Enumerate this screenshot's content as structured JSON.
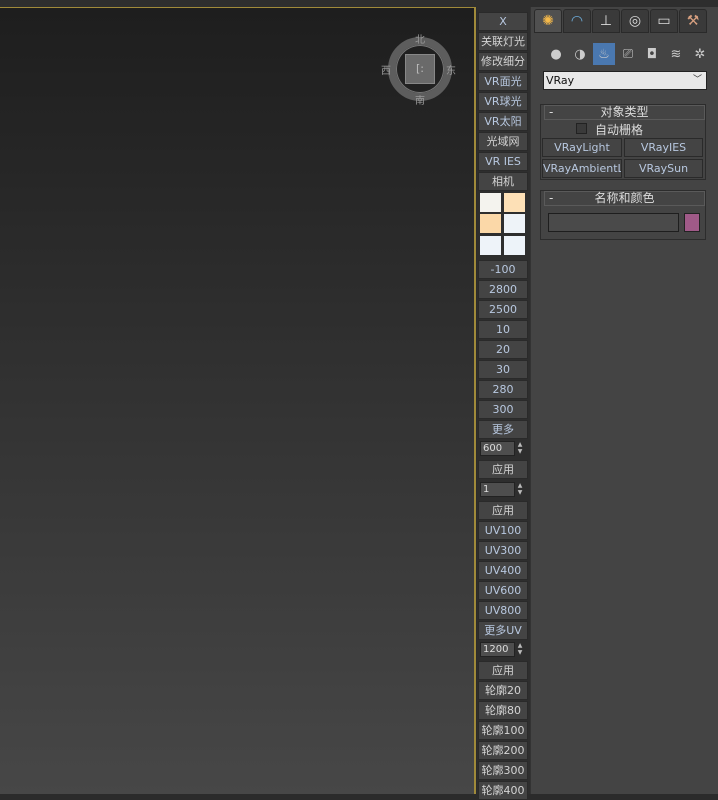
{
  "viewcube": {
    "north": "北",
    "south": "南",
    "east": "东",
    "west": "西",
    "face": "[:"
  },
  "toolbar": {
    "top_buttons": [
      "X",
      "关联灯光",
      "修改细分",
      "VR面光",
      "VR球光",
      "VR太阳",
      "光域网",
      "VR IES",
      "相机"
    ],
    "swatch_colors": [
      "#f4f3ee",
      "#fde0b6",
      "#fbd8a8",
      "#eef3f8",
      "#eef3f9",
      "#edf3f9"
    ],
    "value_buttons": [
      "-100",
      "2800",
      "2500",
      "10",
      "20",
      "30",
      "280",
      "300",
      "更多"
    ],
    "spinner1": "600",
    "apply1": "应用",
    "spinner2": "1",
    "apply2": "应用",
    "uv_buttons": [
      "UV100",
      "UV300",
      "UV400",
      "UV600",
      "UV800",
      "更多UV"
    ],
    "spinner3": "1200",
    "apply3": "应用",
    "outline_buttons": [
      "轮廓20",
      "轮廓80",
      "轮廓100",
      "轮廓200",
      "轮廓300",
      "轮廓400"
    ]
  },
  "panel": {
    "dropdown": "VRay",
    "object_type": {
      "title": "对象类型",
      "autogrid": "自动栅格",
      "buttons": [
        "VRayLight",
        "VRayIES",
        "VRayAmbientLigh",
        "VRaySun"
      ]
    },
    "name_color": {
      "title": "名称和颜色",
      "name_value": "",
      "color": "#a05a88"
    }
  }
}
